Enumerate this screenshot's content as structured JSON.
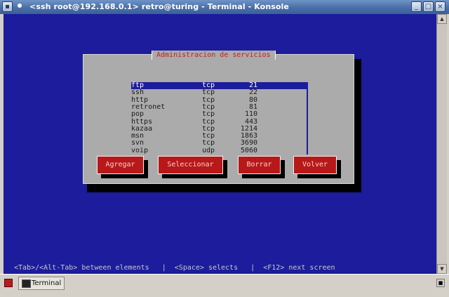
{
  "window": {
    "title": "<ssh root@192.168.0.1> retro@turing - Terminal - Konsole",
    "menu_icon": "window-menu-icon",
    "buttons": [
      "minimize-icon",
      "maximize-icon",
      "close-icon"
    ],
    "button_glyphs": [
      "_",
      "□",
      "×"
    ]
  },
  "dialog": {
    "title": "Administracion de servicios",
    "services": [
      {
        "name": "ftp",
        "proto": "tcp",
        "port": "21"
      },
      {
        "name": "ssh",
        "proto": "tcp",
        "port": "22"
      },
      {
        "name": "http",
        "proto": "tcp",
        "port": "80"
      },
      {
        "name": "retronet",
        "proto": "tcp",
        "port": "81"
      },
      {
        "name": "pop",
        "proto": "tcp",
        "port": "110"
      },
      {
        "name": "https",
        "proto": "tcp",
        "port": "443"
      },
      {
        "name": "kazaa",
        "proto": "tcp",
        "port": "1214"
      },
      {
        "name": "msn",
        "proto": "tcp",
        "port": "1863"
      },
      {
        "name": "svn",
        "proto": "tcp",
        "port": "3690"
      },
      {
        "name": "voip",
        "proto": "udp",
        "port": "5060"
      }
    ],
    "selected_index": 0,
    "buttons": {
      "add": "Agregar",
      "select": "Seleccionar",
      "delete": "Borrar",
      "back": "Volver"
    }
  },
  "hint_bar": "<Tab>/<Alt-Tab> between elements   |  <Space> selects   |  <F12> next screen",
  "taskbar": {
    "tab_label": "Terminal"
  },
  "colors": {
    "terminal_bg": "#1c1c9c",
    "dialog_bg": "#ababab",
    "button_bg": "#b81818",
    "title_text": "#c02020"
  }
}
